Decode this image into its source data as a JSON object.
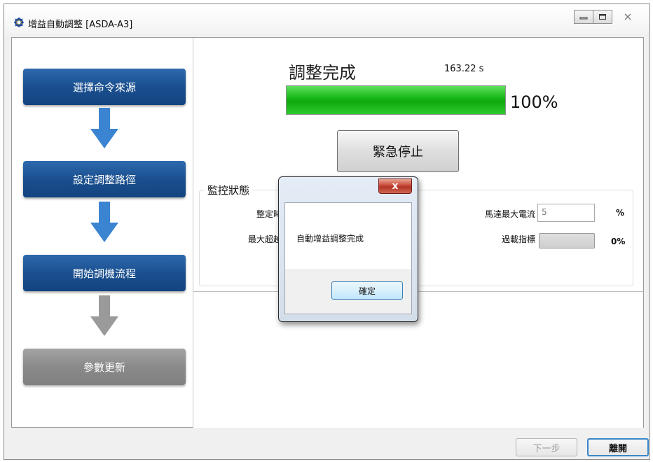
{
  "window": {
    "title": "增益自動調整 [ASDA-A3]",
    "icon": "gear-tuning-icon",
    "controls": [
      "minimize-icon",
      "maximize-icon",
      "close-icon"
    ]
  },
  "steps": [
    {
      "label": "選擇命令來源",
      "state": "done",
      "color": "#1a4f8f"
    },
    {
      "label": "設定調整路徑",
      "state": "done",
      "color": "#1a4f8f"
    },
    {
      "label": "開始調機流程",
      "state": "active",
      "color": "#1a4f8f"
    },
    {
      "label": "參數更新",
      "state": "pending",
      "color": "#8a8a8a"
    }
  ],
  "status": {
    "title": "調整完成",
    "elapsed": "163.22 s",
    "progress_percent": 100,
    "progress_label": "100%",
    "progress_color": "#14b414"
  },
  "emergency_stop": {
    "label": "緊急停止"
  },
  "monitor": {
    "title": "監控狀態",
    "settling_time_label": "整定時間",
    "max_overshoot_label": "最大超越量",
    "motor_max_current_label": "馬達最大電流",
    "motor_max_current_value": "5",
    "motor_max_current_unit": "%",
    "overload_label": "過載指標",
    "overload_value": "0%"
  },
  "footer": {
    "next_label": "下一步",
    "leave_label": "離開"
  },
  "dialog": {
    "message": "自動增益調整完成",
    "ok_label": "確定",
    "close_glyph": "x"
  }
}
